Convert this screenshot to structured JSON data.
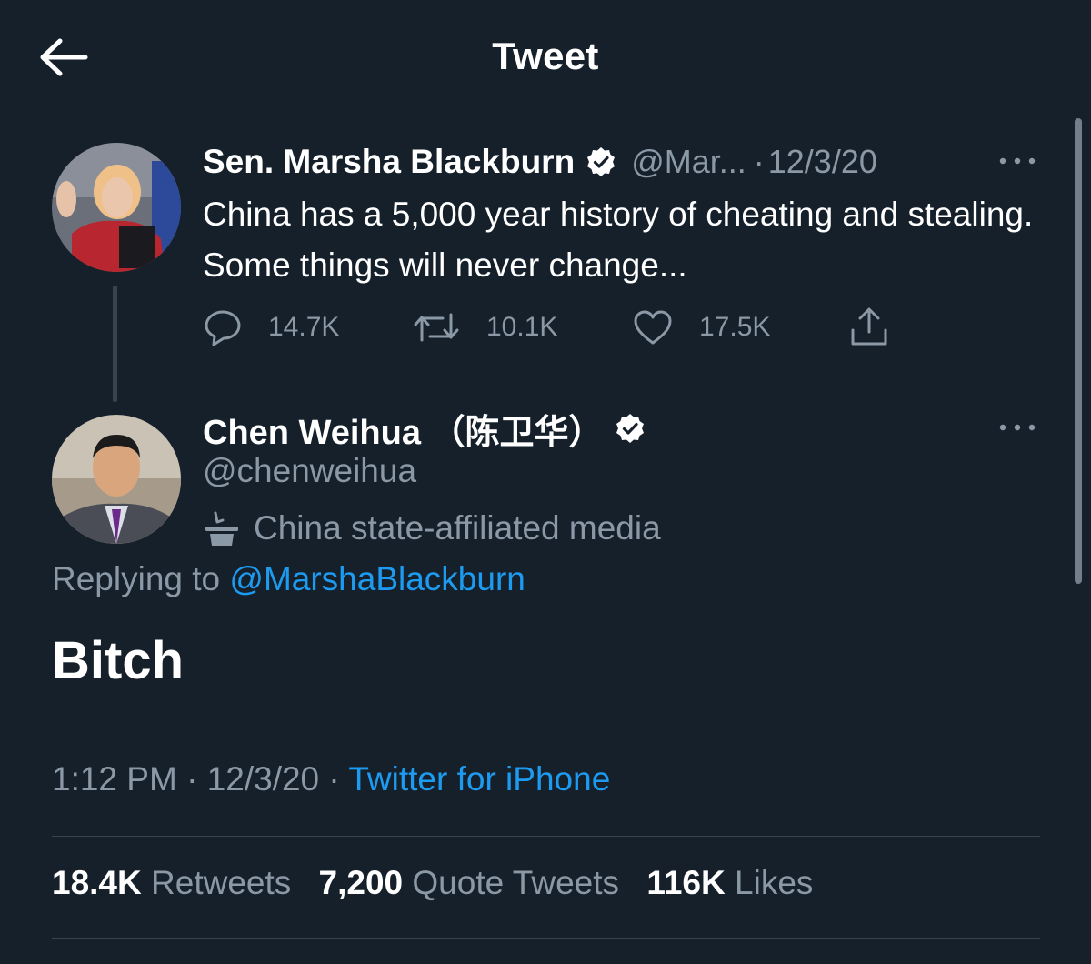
{
  "header": {
    "title": "Tweet",
    "back_icon": "arrow-left-icon"
  },
  "colors": {
    "background": "#15202b",
    "secondary_text": "#8b98a5",
    "link": "#1d9bf0",
    "divider": "#38444d"
  },
  "parent_tweet": {
    "name": "Sen. Marsha Blackburn",
    "handle": "@Mar...",
    "date": "12/3/20",
    "text": "China has a 5,000 year history of cheating and stealing. Some things will never change...",
    "actions": {
      "replies": "14.7K",
      "retweets": "10.1K",
      "likes": "17.5K"
    }
  },
  "main_tweet": {
    "name": "Chen Weihua （陈卫华）",
    "handle": "@chenweihua",
    "affiliation": "China state-affiliated media",
    "replying_prefix": "Replying to",
    "replying_to": "@MarshaBlackburn",
    "text": "Bitch",
    "time": "1:12 PM",
    "date": "12/3/20",
    "source": "Twitter for iPhone",
    "stats": {
      "retweets_count": "18.4K",
      "retweets_label": "Retweets",
      "quotes_count": "7,200",
      "quotes_label": "Quote Tweets",
      "likes_count": "116K",
      "likes_label": "Likes"
    }
  }
}
